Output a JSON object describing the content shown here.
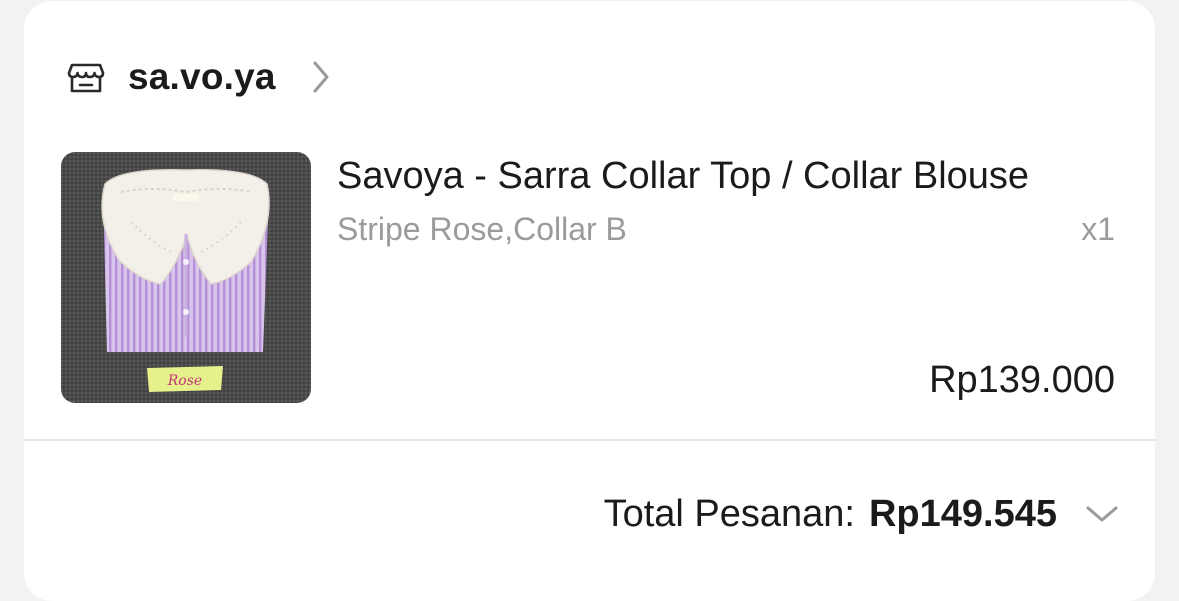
{
  "shop": {
    "name": "sa.vo.ya",
    "icon": "shop-icon"
  },
  "product": {
    "title": "Savoya - Sarra Collar Top / Collar Blouse",
    "variant": "Stripe Rose,Collar B",
    "quantity": "x1",
    "price": "Rp139.000",
    "image_tag": "Rose",
    "image_colors": {
      "background": "#4a4a4a",
      "shirt": "#c8a6e0",
      "collar": "#f4f0ea",
      "tag": "#e8f28a"
    }
  },
  "order": {
    "total_label": "Total Pesanan:",
    "total_value": "Rp149.545",
    "expand_icon": "chevron-down-icon"
  },
  "colors": {
    "text_primary": "#1b1b1b",
    "text_secondary": "#9b9b9b",
    "divider": "#e4e4e6",
    "page_bg": "#f2f2f4",
    "card_bg": "#ffffff"
  }
}
